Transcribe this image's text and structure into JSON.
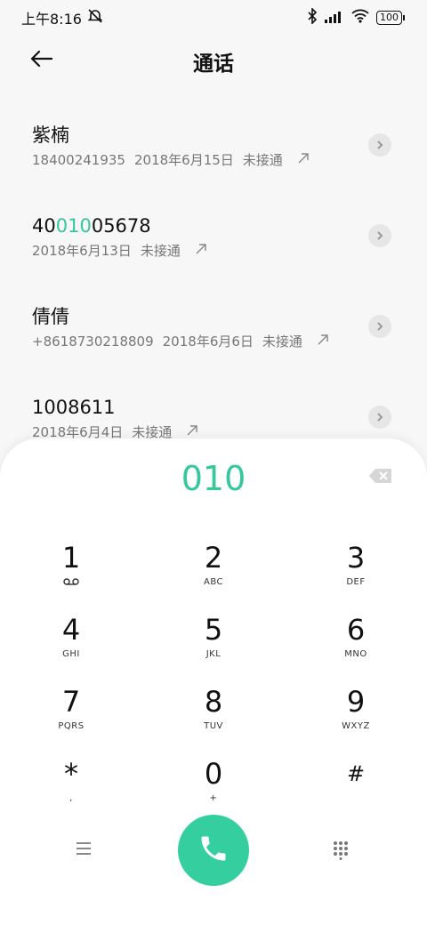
{
  "status_bar": {
    "time": "上午8:16",
    "battery": "100",
    "icons": [
      "alarm-off-icon",
      "bluetooth-icon",
      "signal-icon",
      "wifi-icon",
      "battery-icon"
    ]
  },
  "header": {
    "title": "通话",
    "back_icon": "back-arrow-icon"
  },
  "calls": [
    {
      "name": "紫楠",
      "number": "18400241935",
      "date": "2018年6月15日",
      "status": "未接通"
    },
    {
      "name_parts": [
        "40",
        "010",
        "05678"
      ],
      "date": "2018年6月13日",
      "status": "未接通"
    },
    {
      "name": "倩倩",
      "number": "+8618730218809",
      "date": "2018年6月6日",
      "status": "未接通"
    },
    {
      "name": "1008611",
      "date": "2018年6月4日",
      "status": "未接通"
    }
  ],
  "dialpad": {
    "input": "010",
    "keys": [
      {
        "digit": "1",
        "sub": ""
      },
      {
        "digit": "2",
        "sub": "ABC"
      },
      {
        "digit": "3",
        "sub": "DEF"
      },
      {
        "digit": "4",
        "sub": "GHI"
      },
      {
        "digit": "5",
        "sub": "JKL"
      },
      {
        "digit": "6",
        "sub": "MNO"
      },
      {
        "digit": "7",
        "sub": "PQRS"
      },
      {
        "digit": "8",
        "sub": "TUV"
      },
      {
        "digit": "9",
        "sub": "WXYZ"
      },
      {
        "digit": "*",
        "sub": ","
      },
      {
        "digit": "0",
        "sub": "+"
      },
      {
        "digit": "#",
        "sub": ""
      }
    ]
  },
  "colors": {
    "accent": "#35c89c",
    "call_button": "#35cf9f",
    "background": "#f7f7f7"
  }
}
